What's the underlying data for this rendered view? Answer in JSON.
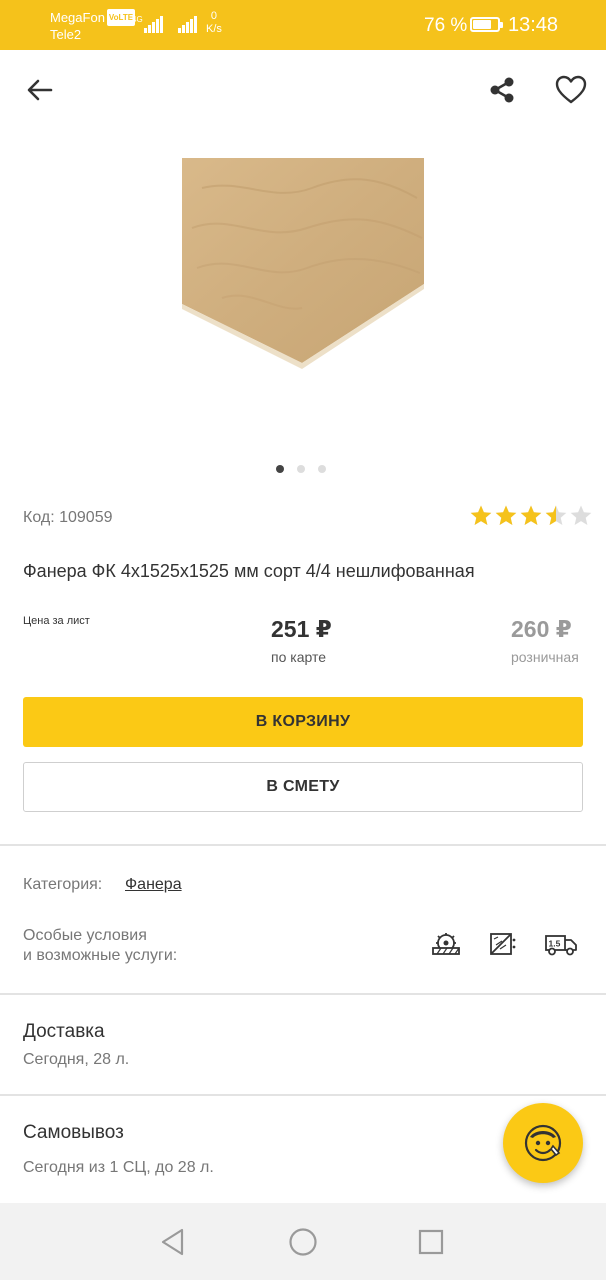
{
  "status_bar": {
    "carrier1": "MegaFon",
    "volte": "VoLTE",
    "carrier2": "Tele2",
    "network": "4G",
    "speed_value": "0",
    "speed_unit": "K/s",
    "battery_percent": "76 %",
    "battery_level": 0.76,
    "time": "13:48"
  },
  "toolbar": {
    "back_icon": "arrow-left-icon",
    "share_icon": "share-icon",
    "favorite_icon": "heart-outline-icon"
  },
  "gallery": {
    "image": "plywood-sheet",
    "page_count": 3,
    "current_page": 1
  },
  "product": {
    "sku": "Код: 109059",
    "rating": 3.5,
    "rating_max": 5,
    "title": "Фанера ФК 4x1525x1525 мм сорт 4/4 нешлифованная"
  },
  "price": {
    "label": "Цена за лист",
    "card_price": "251 ₽",
    "card_label": "по карте",
    "retail_price": "260 ₽",
    "retail_label": "розничная"
  },
  "actions": {
    "cart_label": "В КОРЗИНУ",
    "estimate_label": "В СМЕТУ"
  },
  "details": {
    "category_label": "Категория:",
    "category_value": "Фанера",
    "conditions_line1": "Особые условия",
    "conditions_line2": "и возможные услуги:",
    "service_icons": [
      "saw-cutting-icon",
      "no-cut-icon",
      "truck-1.5t-icon"
    ],
    "truck_capacity": "1.5"
  },
  "delivery": {
    "title": "Доставка",
    "subtitle": "Сегодня, 28 л."
  },
  "pickup": {
    "title": "Самовывоз",
    "subtitle": "Сегодня из 1 СЦ, до 28 л."
  },
  "colors": {
    "accent": "#fbc915",
    "status_bar": "#f5c21b",
    "text_primary": "#333333",
    "text_secondary": "#777777",
    "star": "#f5c21b",
    "star_empty": "#dddddd"
  },
  "fab": {
    "icon": "mascot-assistant-icon"
  },
  "nav_bar": {
    "icons": [
      "nav-back-icon",
      "nav-home-icon",
      "nav-recent-icon"
    ]
  }
}
